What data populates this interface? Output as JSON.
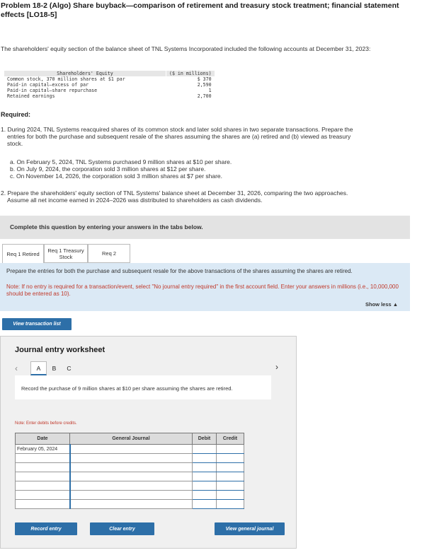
{
  "problem": {
    "title": "Problem 18-2 (Algo) Share buyback—comparison of retirement and treasury stock treatment; financial statement effects [LO18-5]",
    "intro": "The shareholders' equity section of the balance sheet of TNL Systems Incorporated included the following accounts at December 31, 2023:"
  },
  "equity_table": {
    "header": {
      "label": "Shareholders' Equity",
      "unit": "($ in millions)"
    },
    "rows": [
      {
        "label": "Common stock, 370 million shares at $1 par",
        "value": "$ 370"
      },
      {
        "label": "Paid-in capital—excess of par",
        "value": "2,590"
      },
      {
        "label": "Paid-in capital—share repurchase",
        "value": "1"
      },
      {
        "label": "Retained earnings",
        "value": "2,700"
      }
    ]
  },
  "required": {
    "heading": "Required:",
    "req1_line1": "1. During 2024, TNL Systems reacquired shares of its common stock and later sold shares in two separate transactions. Prepare the",
    "req1_line2": "entries for both the purchase and subsequent resale of the shares assuming the shares are (a) retired and (b) viewed as treasury",
    "req1_line3": "stock.",
    "sub_a": "a. On February 5, 2024, TNL Systems purchased 9 million shares at $10 per share.",
    "sub_b": "b. On July 9, 2024, the corporation sold 3 million shares at $12 per share.",
    "sub_c": "c. On November 14, 2026, the corporation sold 3 million shares at $7 per share.",
    "req2_line1": "2. Prepare the shareholders' equity section of TNL Systems' balance sheet at December 31, 2026, comparing the two approaches.",
    "req2_line2": "Assume all net income earned in 2024–2026 was distributed to shareholders as cash dividends."
  },
  "instruction_bar": "Complete this question by entering your answers in the tabs below.",
  "tabs": [
    {
      "label": "Req 1 Retired"
    },
    {
      "label": "Req 1 Treasury Stock"
    },
    {
      "label": "Req 2"
    }
  ],
  "panel": {
    "text": "Prepare the entries for both the purchase and subsequent resale for the above transactions of the shares assuming the shares are retired.",
    "note": "Note: If no entry is required for a transaction/event, select \"No journal entry required\" in the first account field. Enter your answers in millions (i.e., 10,000,000 should be entered as 10).",
    "show_less": "Show less ▲"
  },
  "buttons": {
    "view_transaction_list": "View transaction list",
    "record_entry": "Record entry",
    "clear_entry": "Clear entry",
    "view_general_journal": "View general journal"
  },
  "worksheet": {
    "title": "Journal entry worksheet",
    "nav": [
      "A",
      "B",
      "C"
    ],
    "active_index": 0,
    "instruction": "Record the purchase of 9 million shares at $10 per share assuming the shares are retired.",
    "note": "Note: Enter debits before credits.",
    "columns": [
      "Date",
      "General Journal",
      "Debit",
      "Credit"
    ],
    "date_value": "February 05, 2024"
  },
  "icons": {
    "prev": "chevron-left-icon",
    "next": "chevron-right-icon"
  },
  "colors": {
    "accent": "#2d6fa8",
    "panel_bg": "#dbe9f5",
    "note_red": "#c0392b"
  }
}
